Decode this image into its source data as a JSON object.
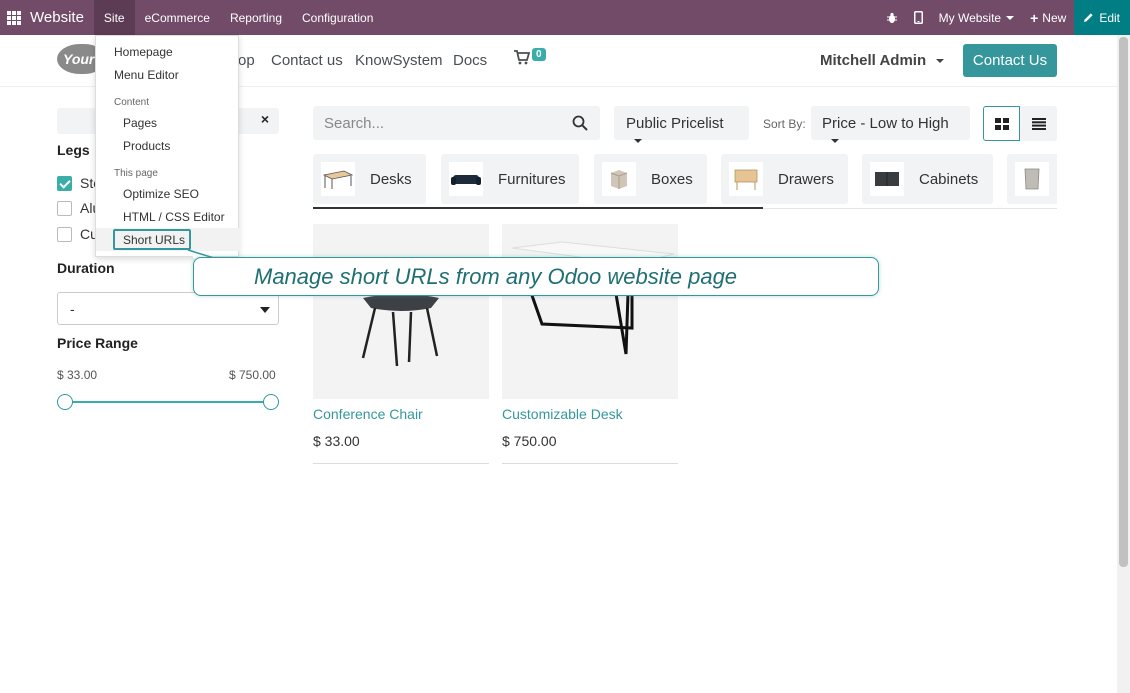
{
  "topbar": {
    "brand": "Website",
    "menus": [
      "Site",
      "eCommerce",
      "Reporting",
      "Configuration"
    ],
    "website_switcher": "My Website",
    "new_label": "New",
    "edit_label": "Edit"
  },
  "header": {
    "logo_text": "Your",
    "nav": [
      "op",
      "Contact us",
      "KnowSystem",
      "Docs"
    ],
    "cart_count": "0",
    "user": "Mitchell Admin",
    "contact_button": "Contact Us"
  },
  "dropdown": {
    "items": [
      "Homepage",
      "Menu Editor"
    ],
    "content_header": "Content",
    "content_items": [
      "Pages",
      "Products"
    ],
    "page_header": "This page",
    "page_items": [
      "Optimize SEO",
      "HTML / CSS Editor",
      "Short URLs"
    ]
  },
  "callout": {
    "text": "Manage short URLs from any Odoo website page"
  },
  "sidebar": {
    "clear_symbol": "×",
    "legs_title": "Legs",
    "legs_options": [
      {
        "label": "Ste",
        "checked": true
      },
      {
        "label": "Alu",
        "checked": false
      },
      {
        "label": "Cu",
        "checked": false
      }
    ],
    "duration_title": "Duration",
    "duration_value": "-",
    "price_title": "Price Range",
    "price_min": "$ 33.00",
    "price_max": "$ 750.00"
  },
  "toolbar": {
    "search_placeholder": "Search...",
    "pricelist": "Public Pricelist",
    "sort_label": "Sort By:",
    "sort_value": "Price - Low to High"
  },
  "categories": [
    "Desks",
    "Furnitures",
    "Boxes",
    "Drawers",
    "Cabinets"
  ],
  "products": [
    {
      "name": "Conference Chair",
      "price": "$ 33.00"
    },
    {
      "name": "Customizable Desk",
      "price": "$ 750.00"
    }
  ],
  "colors": {
    "admin_bar": "#714B67",
    "edit_button": "#017E84",
    "accent": "#35979c"
  }
}
